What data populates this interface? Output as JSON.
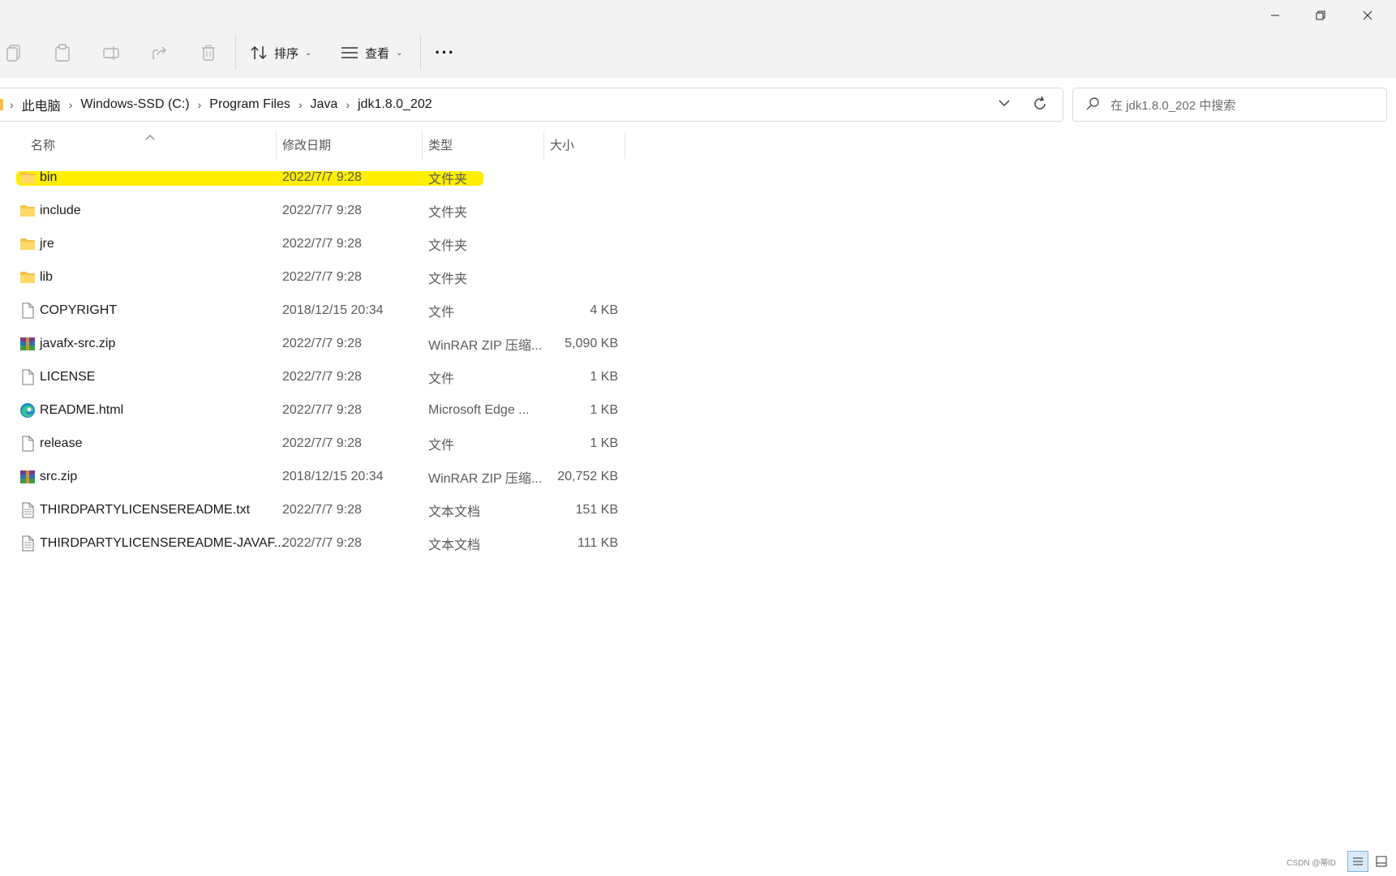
{
  "toolbar": {
    "sort_label": "排序",
    "view_label": "查看",
    "more_label": "···"
  },
  "address": {
    "crumbs": [
      "此电脑",
      "Windows-SSD (C:)",
      "Program Files",
      "Java",
      "jdk1.8.0_202"
    ]
  },
  "search": {
    "placeholder": "在 jdk1.8.0_202 中搜索"
  },
  "columns": {
    "name": "名称",
    "date": "修改日期",
    "type": "类型",
    "size": "大小"
  },
  "files": [
    {
      "name": "bin",
      "date": "2022/7/7 9:28",
      "type": "文件夹",
      "size": "",
      "icon": "folder-icon"
    },
    {
      "name": "include",
      "date": "2022/7/7 9:28",
      "type": "文件夹",
      "size": "",
      "icon": "folder-icon"
    },
    {
      "name": "jre",
      "date": "2022/7/7 9:28",
      "type": "文件夹",
      "size": "",
      "icon": "folder-icon"
    },
    {
      "name": "lib",
      "date": "2022/7/7 9:28",
      "type": "文件夹",
      "size": "",
      "icon": "folder-icon"
    },
    {
      "name": "COPYRIGHT",
      "date": "2018/12/15 20:34",
      "type": "文件",
      "size": "4 KB",
      "icon": "file-icon"
    },
    {
      "name": "javafx-src.zip",
      "date": "2022/7/7 9:28",
      "type": "WinRAR ZIP 压缩...",
      "size": "5,090 KB",
      "icon": "winrar-icon"
    },
    {
      "name": "LICENSE",
      "date": "2022/7/7 9:28",
      "type": "文件",
      "size": "1 KB",
      "icon": "file-icon"
    },
    {
      "name": "README.html",
      "date": "2022/7/7 9:28",
      "type": "Microsoft Edge ...",
      "size": "1 KB",
      "icon": "edge-icon"
    },
    {
      "name": "release",
      "date": "2022/7/7 9:28",
      "type": "文件",
      "size": "1 KB",
      "icon": "file-icon"
    },
    {
      "name": "src.zip",
      "date": "2018/12/15 20:34",
      "type": "WinRAR ZIP 压缩...",
      "size": "20,752 KB",
      "icon": "winrar-icon"
    },
    {
      "name": "THIRDPARTYLICENSEREADME.txt",
      "date": "2022/7/7 9:28",
      "type": "文本文档",
      "size": "151 KB",
      "icon": "text-file-icon"
    },
    {
      "name": "THIRDPARTYLICENSEREADME-JAVAF...",
      "date": "2022/7/7 9:28",
      "type": "文本文档",
      "size": "111 KB",
      "icon": "text-file-icon"
    }
  ],
  "highlighted_row": "bin",
  "watermark": "CSDN @蒂lD",
  "colors": {
    "highlight": "#ffee00",
    "folder": "#f5c242",
    "toolbar_bg": "#f3f3f3"
  }
}
